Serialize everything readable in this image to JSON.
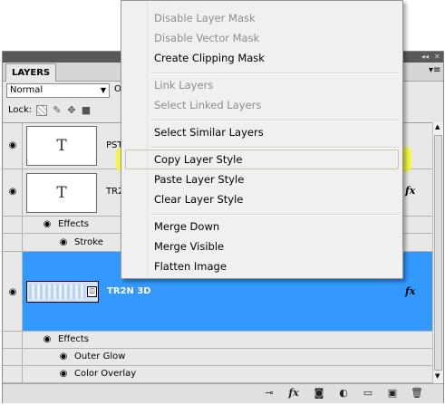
{
  "panel": {
    "tab_label": "LAYERS",
    "titlebar_collapse_glyph": "◂◂",
    "titlebar_close_glyph": "✕",
    "menu_glyph": "▾≡",
    "blend_mode": "Normal",
    "opacity_fragment": "O",
    "lock_label": "Lock:",
    "lock_icons": [
      "lock-transparent-icon",
      "lock-image-icon",
      "lock-position-icon",
      "lock-all-icon"
    ]
  },
  "layers": [
    {
      "name": "PST",
      "thumb": "T",
      "selected": false,
      "has_fx": false
    },
    {
      "name": "TR2",
      "thumb": "T",
      "selected": false,
      "has_fx": true,
      "effects_label": "Effects",
      "effects": [
        "Stroke"
      ]
    },
    {
      "name": "TR2N 3D",
      "thumb": "",
      "selected": true,
      "has_fx": true,
      "effects_label": "Effects",
      "effects": [
        "Outer Glow",
        "Color Overlay"
      ]
    }
  ],
  "fx_glyph": "fx",
  "eye_glyph": "👁",
  "bottom_icons": [
    "link-layers-icon",
    "fx-icon",
    "mask-icon",
    "adjustment-icon",
    "group-folder-icon",
    "new-layer-icon",
    "trash-icon"
  ],
  "bottom_glyphs": {
    "link": "⊸",
    "fx": "fx",
    "mask": "◙",
    "adjust": "◐",
    "folder": "▭",
    "new": "▣",
    "trash": "🗑"
  },
  "context_menu": {
    "items": [
      {
        "label": "Disable Layer Mask",
        "disabled": true
      },
      {
        "label": "Disable Vector Mask",
        "disabled": true
      },
      {
        "label": "Create Clipping Mask",
        "disabled": false
      },
      {
        "label": "Link Layers",
        "disabled": true
      },
      {
        "label": "Select Linked Layers",
        "disabled": true
      },
      {
        "label": "Select Similar Layers",
        "disabled": false
      },
      {
        "label": "Copy Layer Style",
        "disabled": false,
        "highlighted": true
      },
      {
        "label": "Paste Layer Style",
        "disabled": false
      },
      {
        "label": "Clear Layer Style",
        "disabled": false
      },
      {
        "label": "Merge Down",
        "disabled": false
      },
      {
        "label": "Merge Visible",
        "disabled": false
      },
      {
        "label": "Flatten Image",
        "disabled": false
      }
    ]
  },
  "colors": {
    "selection": "#3399ff",
    "highlight": "#f5f53a",
    "disabled_text": "#8d8d8d"
  }
}
